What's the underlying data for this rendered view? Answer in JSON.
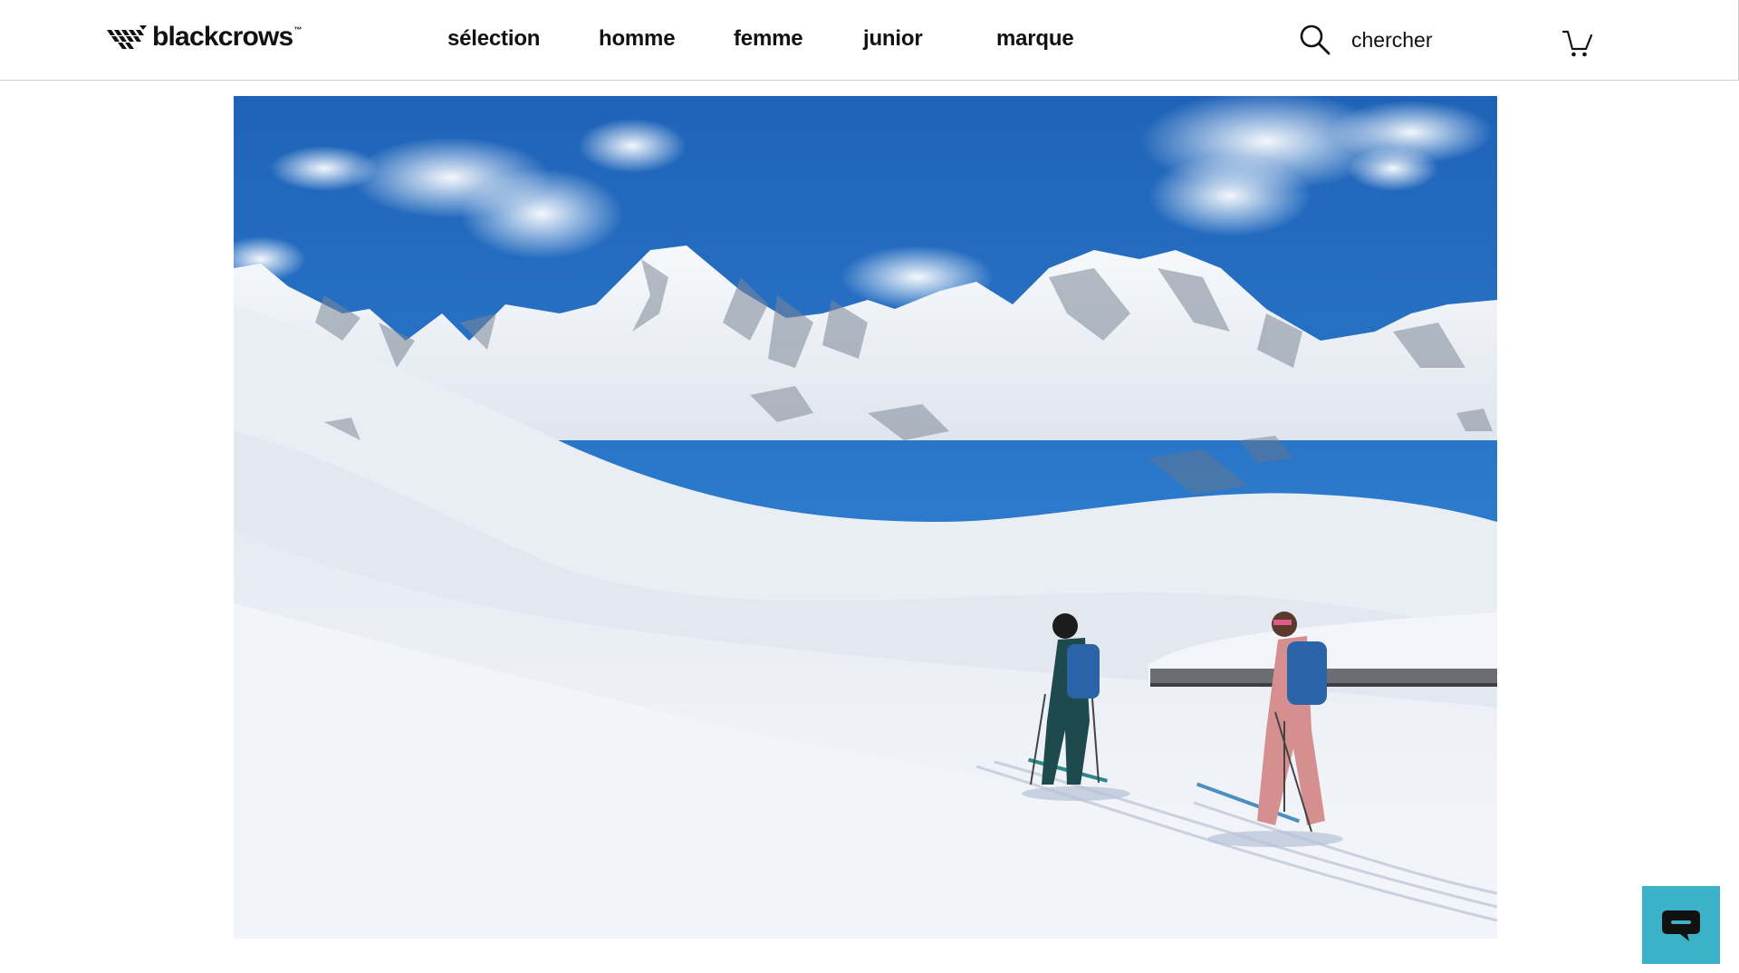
{
  "header": {
    "logo_text": "blackcrows",
    "logo_tm": "™",
    "nav": [
      {
        "label": "sélection"
      },
      {
        "label": "homme"
      },
      {
        "label": "femme"
      },
      {
        "label": "junior"
      },
      {
        "label": "marque"
      }
    ],
    "search": {
      "placeholder": "chercher",
      "icon": "search-icon"
    },
    "cart": {
      "icon": "cart-icon"
    }
  },
  "hero": {
    "image": "ski-touring-mountain-photo"
  },
  "chat": {
    "icon": "chat-bubble-icon",
    "color": "#3bb2c8"
  }
}
